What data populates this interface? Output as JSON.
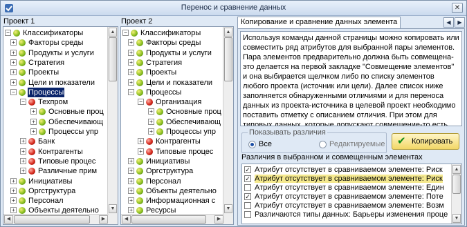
{
  "window": {
    "title": "Перенос и сравнение данных",
    "close_icon": "close-icon"
  },
  "project1": {
    "label": "Проект 1",
    "items": [
      {
        "label": "Классификаторы",
        "expander": "−",
        "color": "green",
        "level": 0
      },
      {
        "label": "Факторы среды",
        "expander": "+",
        "color": "green",
        "level": 1
      },
      {
        "label": "Продукты и услуги",
        "expander": "+",
        "color": "green",
        "level": 1
      },
      {
        "label": "Стратегия",
        "expander": "+",
        "color": "green",
        "level": 1
      },
      {
        "label": "Проекты",
        "expander": "+",
        "color": "green",
        "level": 1
      },
      {
        "label": "Цели и показатели",
        "expander": "+",
        "color": "green",
        "level": 1
      },
      {
        "label": "Процессы",
        "expander": "−",
        "color": "green",
        "level": 1,
        "selected": true
      },
      {
        "label": "Техпром",
        "expander": "−",
        "color": "red",
        "level": 2
      },
      {
        "label": "Основные проц",
        "expander": "+",
        "color": "green",
        "level": 3
      },
      {
        "label": "Обеспечивающ",
        "expander": "+",
        "color": "green",
        "level": 3
      },
      {
        "label": "Процессы упр",
        "expander": "+",
        "color": "green",
        "level": 3
      },
      {
        "label": "Банк",
        "expander": "+",
        "color": "red",
        "level": 2
      },
      {
        "label": "Контрагенты",
        "expander": "+",
        "color": "red",
        "level": 2
      },
      {
        "label": "Типовые процес",
        "expander": "+",
        "color": "red",
        "level": 2
      },
      {
        "label": "Различные прим",
        "expander": "+",
        "color": "red",
        "level": 2
      },
      {
        "label": "Инициативы",
        "expander": "+",
        "color": "green",
        "level": 1
      },
      {
        "label": "Оргструктура",
        "expander": "+",
        "color": "green",
        "level": 1
      },
      {
        "label": "Персонал",
        "expander": "+",
        "color": "green",
        "level": 1
      },
      {
        "label": "Объекты деятельно",
        "expander": "+",
        "color": "green",
        "level": 1
      }
    ]
  },
  "project2": {
    "label": "Проект 2",
    "items": [
      {
        "label": "Классификаторы",
        "expander": "−",
        "color": "green",
        "level": 0
      },
      {
        "label": "Факторы среды",
        "expander": "+",
        "color": "green",
        "level": 1
      },
      {
        "label": "Продукты и услуги",
        "expander": "+",
        "color": "green",
        "level": 1
      },
      {
        "label": "Стратегия",
        "expander": "+",
        "color": "green",
        "level": 1
      },
      {
        "label": "Проекты",
        "expander": "+",
        "color": "green",
        "level": 1
      },
      {
        "label": "Цели и показатели",
        "expander": "+",
        "color": "green",
        "level": 1
      },
      {
        "label": "Процессы",
        "expander": "−",
        "color": "green",
        "level": 1
      },
      {
        "label": "Организация",
        "expander": "−",
        "color": "red",
        "level": 2
      },
      {
        "label": "Основные проц",
        "expander": "+",
        "color": "green",
        "level": 3
      },
      {
        "label": "Обеспечивающ",
        "expander": "+",
        "color": "green",
        "level": 3
      },
      {
        "label": "Процессы упр",
        "expander": "+",
        "color": "green",
        "level": 3
      },
      {
        "label": "Контрагенты",
        "expander": "+",
        "color": "red",
        "level": 2
      },
      {
        "label": "Типовые процес",
        "expander": "+",
        "color": "red",
        "level": 2
      },
      {
        "label": "Инициативы",
        "expander": "+",
        "color": "green",
        "level": 1
      },
      {
        "label": "Оргструктура",
        "expander": "+",
        "color": "green",
        "level": 1
      },
      {
        "label": "Персонал",
        "expander": "+",
        "color": "green",
        "level": 1
      },
      {
        "label": "Объекты деятельно",
        "expander": "+",
        "color": "green",
        "level": 1
      },
      {
        "label": "Информационная с",
        "expander": "+",
        "color": "green",
        "level": 1
      },
      {
        "label": "Ресурсы",
        "expander": "+",
        "color": "green",
        "level": 1
      }
    ]
  },
  "tab": {
    "label": "Копирование и сравнение данных элемента",
    "prev_icon": "◀",
    "next_icon": "▶"
  },
  "description": "Используя команды данной страницы можно копировать или совместить ряд атрибутов для выбранной пары элементов. Пара элементов предварительно должна быть совмещена-это делается на первой закладке \"Совмещение элементов\" и она выбирается щелчком либо по списку элементов любого проекта (источник или цели). Далее список ниже заполняется обнаруженными отличиями и для переноса данных из проекта-источника в целевой проект необходимо поставить отметку с описанием отличия. При этом для типовых данных, которые допускают совмещение-то есть добавление данных",
  "show_diff": {
    "title": "Показывать различия",
    "all": "Все",
    "editable": "Редактируемые",
    "selected": "all"
  },
  "copy_button": {
    "label": "Копировать",
    "icon": "check-icon"
  },
  "diffs": {
    "header": "Различия в выбранном и совмещенным элементах",
    "items": [
      {
        "text": "Атрибут отсутствует в сравниваемом элементе: Риск",
        "checked": true,
        "highlight": false
      },
      {
        "text": "Атрибут отсутствует в сравниваемом элементе: Риск",
        "checked": true,
        "highlight": true
      },
      {
        "text": "Атрибут отсутствует в сравниваемом элементе: Един",
        "checked": false,
        "highlight": false
      },
      {
        "text": "Атрибут отсутствует в сравниваемом элементе: Поте",
        "checked": true,
        "highlight": false
      },
      {
        "text": "Атрибут отсутствует в сравниваемом элементе: Возм",
        "checked": false,
        "highlight": false
      },
      {
        "text": "Различаются типы данных: Барьеры изменения проце",
        "checked": false,
        "highlight": false
      }
    ]
  }
}
